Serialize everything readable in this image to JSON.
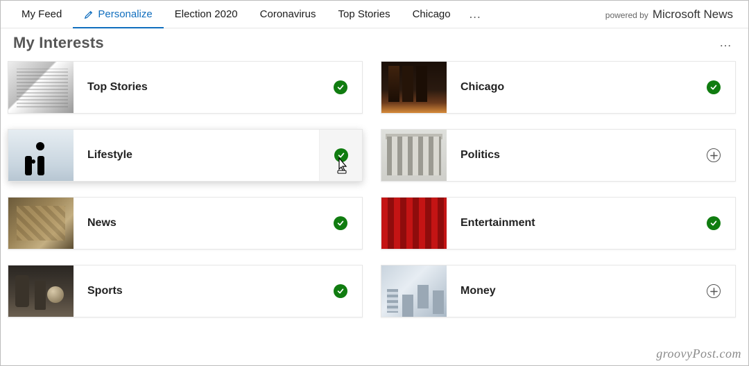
{
  "tabs": {
    "items": [
      {
        "label": "My Feed",
        "key": "my-feed",
        "active": false
      },
      {
        "label": "Personalize",
        "key": "personalize",
        "active": true,
        "icon": "pencil"
      },
      {
        "label": "Election 2020",
        "key": "election-2020",
        "active": false
      },
      {
        "label": "Coronavirus",
        "key": "coronavirus",
        "active": false
      },
      {
        "label": "Top Stories",
        "key": "top-stories",
        "active": false
      },
      {
        "label": "Chicago",
        "key": "chicago",
        "active": false
      }
    ],
    "more": "…"
  },
  "powered_by": {
    "prefix": "powered by",
    "brand": "Microsoft News"
  },
  "section_title": "My Interests",
  "section_more": "…",
  "cards": {
    "left": [
      {
        "key": "top-stories",
        "label": "Top Stories",
        "followed": true,
        "thumb": "th-newspaper"
      },
      {
        "key": "lifestyle",
        "label": "Lifestyle",
        "followed": true,
        "thumb": "th-lifestyle",
        "hover": true
      },
      {
        "key": "news",
        "label": "News",
        "followed": true,
        "thumb": "th-news"
      },
      {
        "key": "sports",
        "label": "Sports",
        "followed": true,
        "thumb": "th-sports"
      }
    ],
    "right": [
      {
        "key": "chicago",
        "label": "Chicago",
        "followed": true,
        "thumb": "th-chicago"
      },
      {
        "key": "politics",
        "label": "Politics",
        "followed": false,
        "thumb": "th-politics"
      },
      {
        "key": "entertainment",
        "label": "Entertainment",
        "followed": true,
        "thumb": "th-entertainment"
      },
      {
        "key": "money",
        "label": "Money",
        "followed": false,
        "thumb": "th-money"
      }
    ]
  },
  "watermark": "groovyPost.com",
  "colors": {
    "accent": "#106ebe",
    "followed": "#107c10"
  }
}
